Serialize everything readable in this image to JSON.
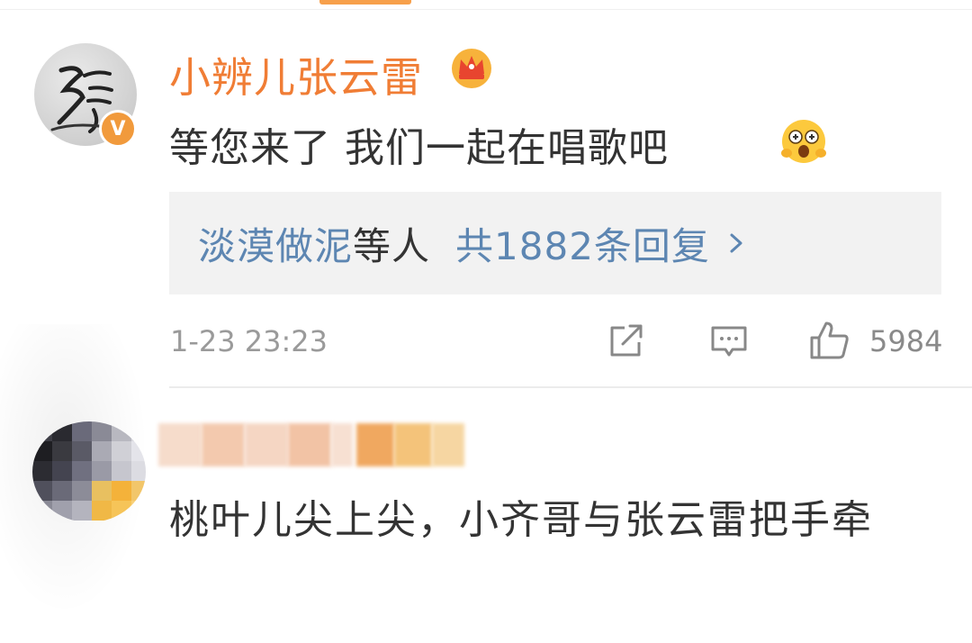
{
  "comment_main": {
    "username": "小辨儿张云雷",
    "avatar_char": "張",
    "verified_badge": "V",
    "text": "等您来了 我们一起在唱歌吧",
    "emoji": "shocked-face-emoji",
    "reply_summary": {
      "names": "淡漠做泥",
      "suffix": "等人",
      "count_text": "共1882条回复"
    },
    "timestamp": "1-23 23:23",
    "like_count": "5984"
  },
  "comment_second": {
    "username": "",
    "text": "桃叶儿尖上尖，小齐哥与张云雷把手牵"
  },
  "colors": {
    "username": "#f07d35",
    "link": "#5d86b2",
    "text": "#333333",
    "meta": "#9a9a9a",
    "reply_bg": "#f2f2f2"
  },
  "icons": [
    "crown-icon",
    "shocked-face-emoji",
    "chevron-right-icon",
    "share-icon",
    "comment-icon",
    "like-icon"
  ]
}
